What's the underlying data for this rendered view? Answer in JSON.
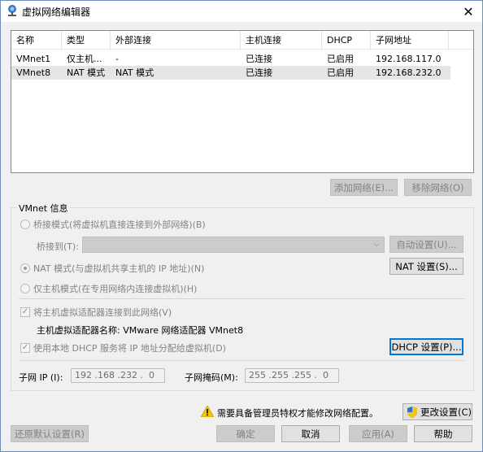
{
  "window": {
    "title": "虚拟网络编辑器",
    "close_symbol": "✕"
  },
  "table": {
    "headers": [
      "名称",
      "类型",
      "外部连接",
      "主机连接",
      "DHCP",
      "子网地址"
    ],
    "rows": [
      [
        "VMnet1",
        "仅主机...",
        "-",
        "已连接",
        "已启用",
        "192.168.117.0"
      ],
      [
        "VMnet8",
        "NAT 模式",
        "NAT 模式",
        "已连接",
        "已启用",
        "192.168.232.0"
      ]
    ]
  },
  "network_buttons": {
    "add": "添加网络(E)...",
    "remove": "移除网络(O)"
  },
  "vmnet_info": {
    "group_label": "VMnet 信息",
    "bridge_mode": "桥接模式(将虚拟机直接连接到外部网络)(B)",
    "bridge_to_label": "桥接到(T):",
    "bridge_to_value": "",
    "auto_settings": "自动设置(U)...",
    "nat_mode": "NAT 模式(与虚拟机共享主机的 IP 地址)(N)",
    "nat_settings": "NAT 设置(S)...",
    "host_only_mode": "仅主机模式(在专用网络内连接虚拟机)(H)",
    "connect_host_adapter": "将主机虚拟适配器连接到此网络(V)",
    "host_adapter_name": "主机虚拟适配器名称: VMware 网络适配器 VMnet8",
    "use_dhcp": "使用本地 DHCP 服务将 IP 地址分配给虚拟机(D)",
    "dhcp_settings": "DHCP 设置(P)...",
    "subnet_ip_label": "子网 IP (I):",
    "subnet_ip_value": "192 .168 .232 .  0",
    "subnet_mask_label": "子网掩码(M):",
    "subnet_mask_value": "255 .255 .255 .  0",
    "selected_mode": "nat",
    "connect_host_adapter_checked": true,
    "use_dhcp_checked": true
  },
  "admin": {
    "warning": "需要具备管理员特权才能修改网络配置。",
    "change_settings": "更改设置(C)"
  },
  "footer": {
    "restore_defaults": "还原默认设置(R)",
    "ok": "确定",
    "cancel": "取消",
    "apply": "应用(A)",
    "help": "帮助"
  },
  "colors": {
    "accent": "#0078d7",
    "warning": "#f5c400"
  }
}
